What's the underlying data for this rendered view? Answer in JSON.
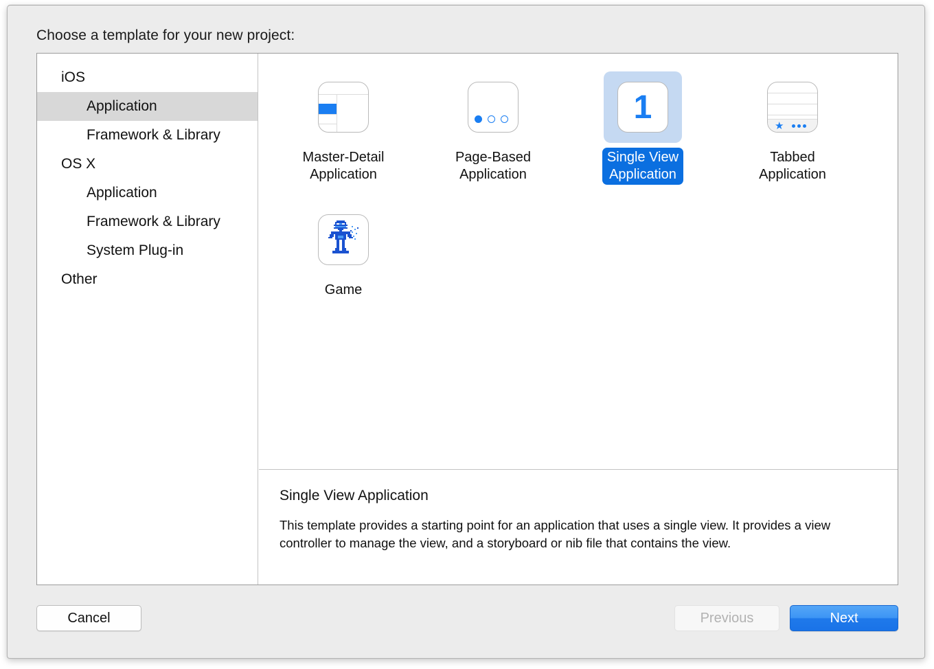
{
  "header": {
    "title": "Choose a template for your new project:"
  },
  "sidebar": {
    "items": [
      {
        "label": "iOS",
        "level": 0,
        "selected": false
      },
      {
        "label": "Application",
        "level": 1,
        "selected": true
      },
      {
        "label": "Framework & Library",
        "level": 1,
        "selected": false
      },
      {
        "label": "OS X",
        "level": 0,
        "selected": false
      },
      {
        "label": "Application",
        "level": 1,
        "selected": false
      },
      {
        "label": "Framework & Library",
        "level": 1,
        "selected": false
      },
      {
        "label": "System Plug-in",
        "level": 1,
        "selected": false
      },
      {
        "label": "Other",
        "level": 0,
        "selected": false
      }
    ]
  },
  "templates": [
    {
      "label": "Master-Detail\nApplication",
      "icon": "master-detail-icon",
      "selected": false
    },
    {
      "label": "Page-Based\nApplication",
      "icon": "page-based-icon",
      "selected": false
    },
    {
      "label": "Single View\nApplication",
      "icon": "single-view-icon",
      "icon_text": "1",
      "selected": true
    },
    {
      "label": "Tabbed\nApplication",
      "icon": "tabbed-icon",
      "selected": false
    },
    {
      "label": "Game",
      "icon": "game-robot-icon",
      "selected": false
    }
  ],
  "description": {
    "title": "Single View Application",
    "body": "This template provides a starting point for an application that uses a single view. It provides a view controller to manage the view, and a storyboard or nib file that contains the view."
  },
  "footer": {
    "cancel_label": "Cancel",
    "previous_label": "Previous",
    "next_label": "Next"
  },
  "colors": {
    "accent_blue": "#1a7ef2",
    "selection_pill": "#0b6fe0",
    "selection_halo": "#c5d9f2",
    "sidebar_selected": "#d8d8d8",
    "window_bg": "#ececec"
  }
}
